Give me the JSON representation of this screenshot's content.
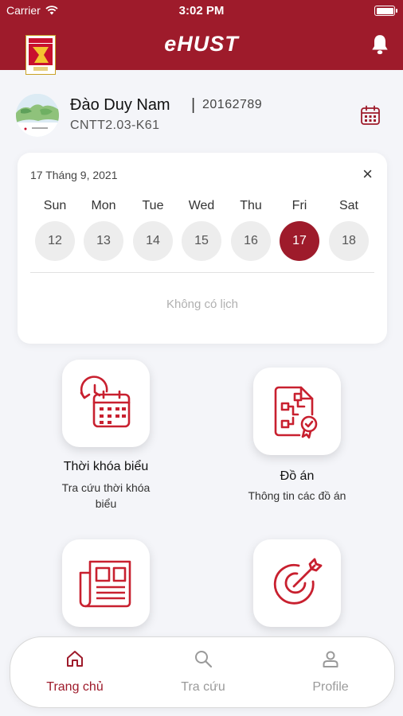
{
  "status_bar": {
    "carrier": "Carrier",
    "time": "3:02 PM"
  },
  "header": {
    "title": "eHUST"
  },
  "profile": {
    "name": "Đào Duy Nam",
    "separator": "|",
    "student_id": "20162789",
    "class": "CNTT2.03-K61"
  },
  "schedule_card": {
    "date": "17 Tháng 9, 2021",
    "close": "×",
    "days": [
      {
        "name": "Sun",
        "num": "12"
      },
      {
        "name": "Mon",
        "num": "13"
      },
      {
        "name": "Tue",
        "num": "14"
      },
      {
        "name": "Wed",
        "num": "15"
      },
      {
        "name": "Thu",
        "num": "16"
      },
      {
        "name": "Fri",
        "num": "17"
      },
      {
        "name": "Sat",
        "num": "18"
      }
    ],
    "selected_day": "17",
    "empty_text": "Không có lịch"
  },
  "features": [
    {
      "title": "Thời khóa biểu",
      "subtitle_line1": "Tra cứu thời khóa",
      "subtitle_line2": "biểu",
      "icon": "timetable-icon"
    },
    {
      "title": "Đồ án",
      "subtitle_line1": "Thông tin các đồ án",
      "icon": "project-document-icon"
    },
    {
      "title": "",
      "icon": "newspaper-icon"
    },
    {
      "title": "",
      "icon": "target-icon"
    }
  ],
  "bottom_nav": [
    {
      "label": "Trang chủ",
      "icon": "home-icon",
      "active": true
    },
    {
      "label": "Tra cứu",
      "icon": "search-icon",
      "active": false
    },
    {
      "label": "Profile",
      "icon": "user-icon",
      "active": false
    }
  ],
  "colors": {
    "accent": "#9e1b2b",
    "background": "#f4f5f9",
    "inactive": "#9a9a9a"
  }
}
